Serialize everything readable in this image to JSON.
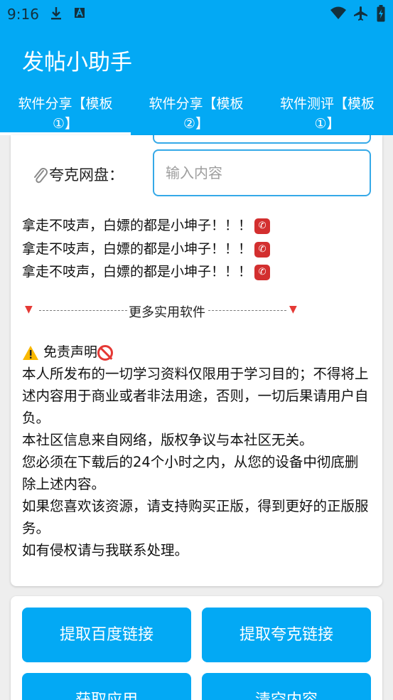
{
  "status_bar": {
    "time": "9:16"
  },
  "app_bar": {
    "title": "发帖小助手"
  },
  "tabs": [
    {
      "line1": "软件分享【模板",
      "line2": "①】"
    },
    {
      "line1": "软件分享【模板",
      "line2": "②】"
    },
    {
      "line1": "软件测评【模板",
      "line2": "①】"
    }
  ],
  "form": {
    "quark_label": "夸克网盘：",
    "quark_placeholder": "输入内容"
  },
  "notice_lines": [
    "拿走不吱声，白嫖的都是小坤子！！！",
    "拿走不吱声，白嫖的都是小坤子！！！",
    "拿走不吱声，白嫖的都是小坤子！！！"
  ],
  "divider_text": "更多实用软件",
  "disclaimer": {
    "title": "免责声明",
    "body": "本人所发布的一切学习资料仅限用于学习目的；不得将上述内容用于商业或者非法用途，否则，一切后果请用户自负。\n本社区信息来自网络，版权争议与本社区无关。\n您必须在下载后的24个小时之内，从您的设备中彻底删除上述内容。\n如果您喜欢该资源，请支持购买正版，得到更好的正版服务。\n如有侵权请与我联系处理。"
  },
  "buttons": {
    "baidu": "提取百度链接",
    "quark": "提取夸克链接",
    "get_app": "获取应用",
    "clear": "清空内容"
  }
}
